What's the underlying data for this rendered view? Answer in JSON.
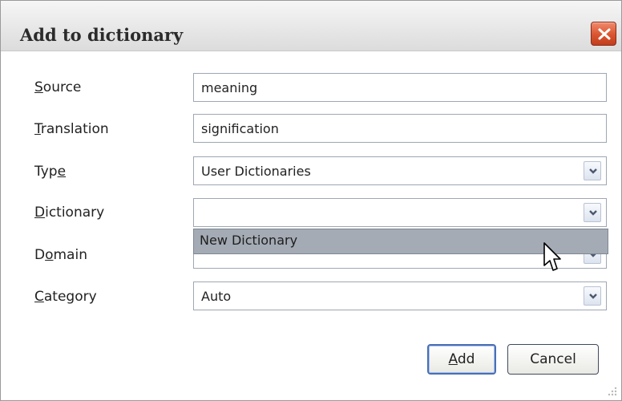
{
  "dialog": {
    "title": "Add to dictionary",
    "close_icon": "close-icon"
  },
  "form": {
    "source": {
      "label": "Source",
      "label_hotkey": "S",
      "label_rest": "ource",
      "value": "meaning"
    },
    "translation": {
      "label": "Translation",
      "label_hotkey": "T",
      "label_rest": "ranslation",
      "value": "signification"
    },
    "type": {
      "label": "Type",
      "label_before": "Typ",
      "label_hotkey": "e",
      "value": "User Dictionaries"
    },
    "dictionary": {
      "label": "Dictionary",
      "label_hotkey": "D",
      "label_rest": "ictionary",
      "value": ""
    },
    "domain": {
      "label": "Domain",
      "label_before": "D",
      "label_hotkey": "o",
      "label_rest": "main",
      "value": ""
    },
    "category": {
      "label": "Category",
      "label_hotkey": "C",
      "label_rest": "ategory",
      "value": "Auto"
    }
  },
  "dropdown": {
    "items": [
      "New Dictionary"
    ],
    "highlighted": "New Dictionary"
  },
  "buttons": {
    "add": {
      "label": "Add",
      "hotkey": "A",
      "rest": "dd"
    },
    "cancel": {
      "label": "Cancel"
    }
  },
  "colors": {
    "close_button": "#d9552f",
    "dropdown_highlight": "#a4abb4",
    "default_button_border": "#4a6fb5"
  }
}
